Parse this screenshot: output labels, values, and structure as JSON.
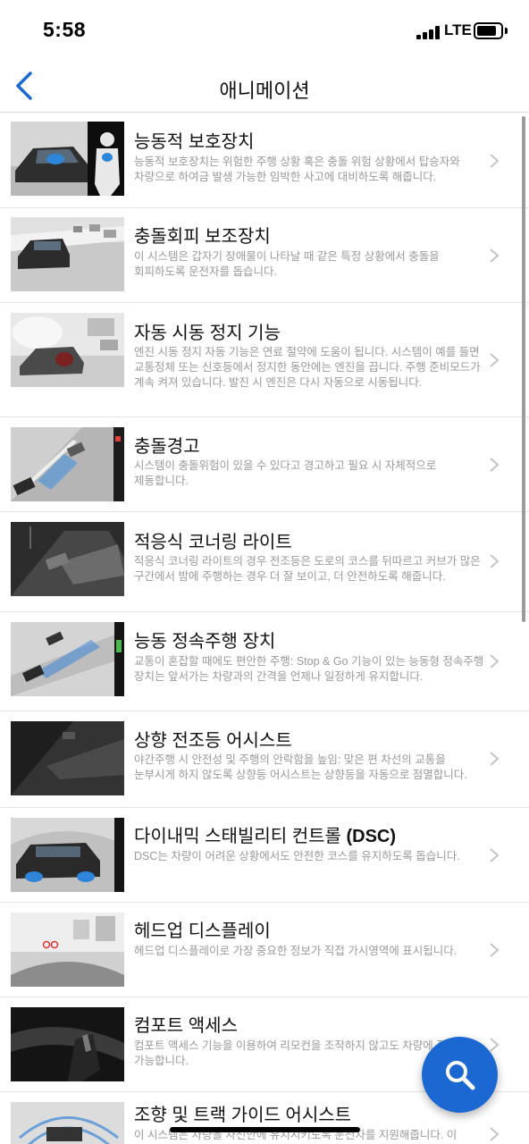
{
  "status": {
    "time": "5:58",
    "network": "LTE"
  },
  "nav": {
    "title": "애니메이션",
    "back_icon": "chevron-left-icon"
  },
  "items": [
    {
      "title": "능동적 보호장치",
      "desc": "능동적 보호장치는 위험한 주행 상황 혹은 충돌 위험 상황에서 탑승자와 차량으로 하여금 발생 가능한 임박한 사고에 대비하도록 해줍니다."
    },
    {
      "title": "충돌회피 보조장치",
      "desc": "이 시스템은 갑자기 장애물이 나타날 때 같은 특정 상황에서 충돌을 회피하도록 운전자를 돕습니다."
    },
    {
      "title": "자동 시동 정지 기능",
      "desc": "엔진 시동 정지 자동 기능은 연료 절약에 도움이 됩니다. 시스템이 예를 들면 교통정체 또는 신호등에서 정지한 동안에는 엔진을 끕니다. 주행 준비모드가 계속 켜져 있습니다. 발진 시 엔진은 다시 자동으로 시동됩니다."
    },
    {
      "title": "충돌경고",
      "desc": "시스템이 충돌위험이 있을 수 있다고 경고하고 필요 시 자체적으로 제동합니다."
    },
    {
      "title": "적응식 코너링 라이트",
      "desc": "적응식 코너링 라이트의 경우 전조등은 도로의 코스를 뒤따르고 커브가 많은 구간에서 밤에 주행하는 경우 더 잘 보이고, 더 안전하도록 해줍니다."
    },
    {
      "title": "능동 정속주행 장치",
      "desc": "교통이 혼잡할 때에도 편안한 주행: Stop & Go 기능이 있는 능동형 정속주행 장치는 앞서가는 차량과의 간격을 언제나 일정하게 유지합니다."
    },
    {
      "title": "상향 전조등 어시스트",
      "desc": "야간주행 시 안전성 및 주행의 안락함을 높임: 맞은 편 차선의 교통을 눈부시게 하지 않도록 상향등 어시스트는 상향등을 자동으로 점멸합니다."
    },
    {
      "title": "다이내믹 스태빌리티 컨트롤",
      "title_suffix": "(DSC)",
      "desc": "DSC는 차량이 어려운 상황에서도 안전한 코스를 유지하도록 돕습니다."
    },
    {
      "title": "헤드업 디스플레이",
      "desc": "헤드업 디스플레이로 가장 중요한 정보가 직접 가시영역에 표시됩니다."
    },
    {
      "title": "컴포트 액세스",
      "desc": "컴포트 액세스 기능을 이용하여 리모컨을 조작하지 않고도 차량에 접근이 가능합니다."
    },
    {
      "title": "조향 및 트랙 가이드 어시스트",
      "desc": "이 시스템은 차량을 차선안에 유지시키도록 운전자를 지원해줍니다. 이"
    }
  ],
  "fab": {
    "icon": "search-icon"
  },
  "colors": {
    "accent": "#1b68d2",
    "desc_text": "#9a9a9a",
    "divider": "#e3e3e3"
  }
}
